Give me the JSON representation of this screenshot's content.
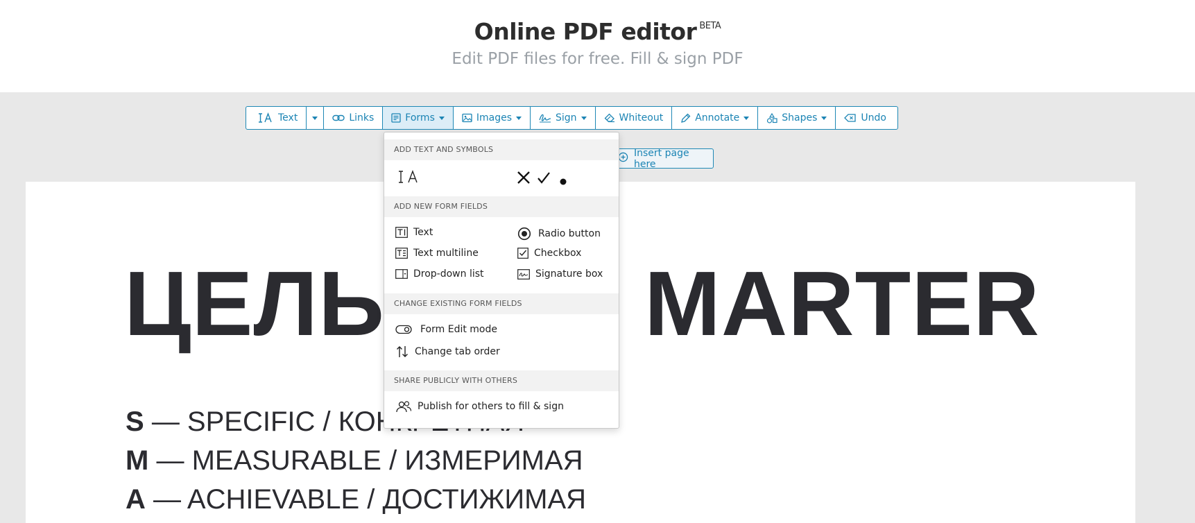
{
  "header": {
    "title": "Online PDF editor",
    "badge": "BETA",
    "subtitle": "Edit PDF files for free. Fill & sign PDF"
  },
  "toolbar": {
    "text": "Text",
    "links": "Links",
    "forms": "Forms",
    "images": "Images",
    "sign": "Sign",
    "whiteout": "Whiteout",
    "annotate": "Annotate",
    "shapes": "Shapes",
    "undo": "Undo"
  },
  "insert_page": "Insert page here",
  "document": {
    "heading_left": "ЦЕЛЬ",
    "heading_right": "MARTER",
    "lines": [
      {
        "letter": "S",
        "text": "— SPECIFIC / КОНКРЕТНАЯ"
      },
      {
        "letter": "M",
        "text": "— MEASURABLE / ИЗМЕРИМАЯ"
      },
      {
        "letter": "A",
        "text": "— ACHIEVABLE / ДОСТИЖИМАЯ"
      }
    ]
  },
  "forms_menu": {
    "section_add_text": "ADD TEXT AND SYMBOLS",
    "section_new_fields": "ADD NEW FORM FIELDS",
    "new_fields": {
      "text": "Text",
      "text_multiline": "Text multiline",
      "dropdown": "Drop-down list",
      "radio": "Radio button",
      "checkbox": "Checkbox",
      "signature": "Signature box"
    },
    "section_change_fields": "CHANGE EXISTING FORM FIELDS",
    "form_edit_mode": "Form Edit mode",
    "change_tab_order": "Change tab order",
    "section_share": "SHARE PUBLICLY WITH OTHERS",
    "publish": "Publish for others to fill & sign"
  },
  "colors": {
    "accent": "#1b84b4",
    "text_dark": "#2b2b30",
    "subtitle": "#9aa0a6"
  }
}
